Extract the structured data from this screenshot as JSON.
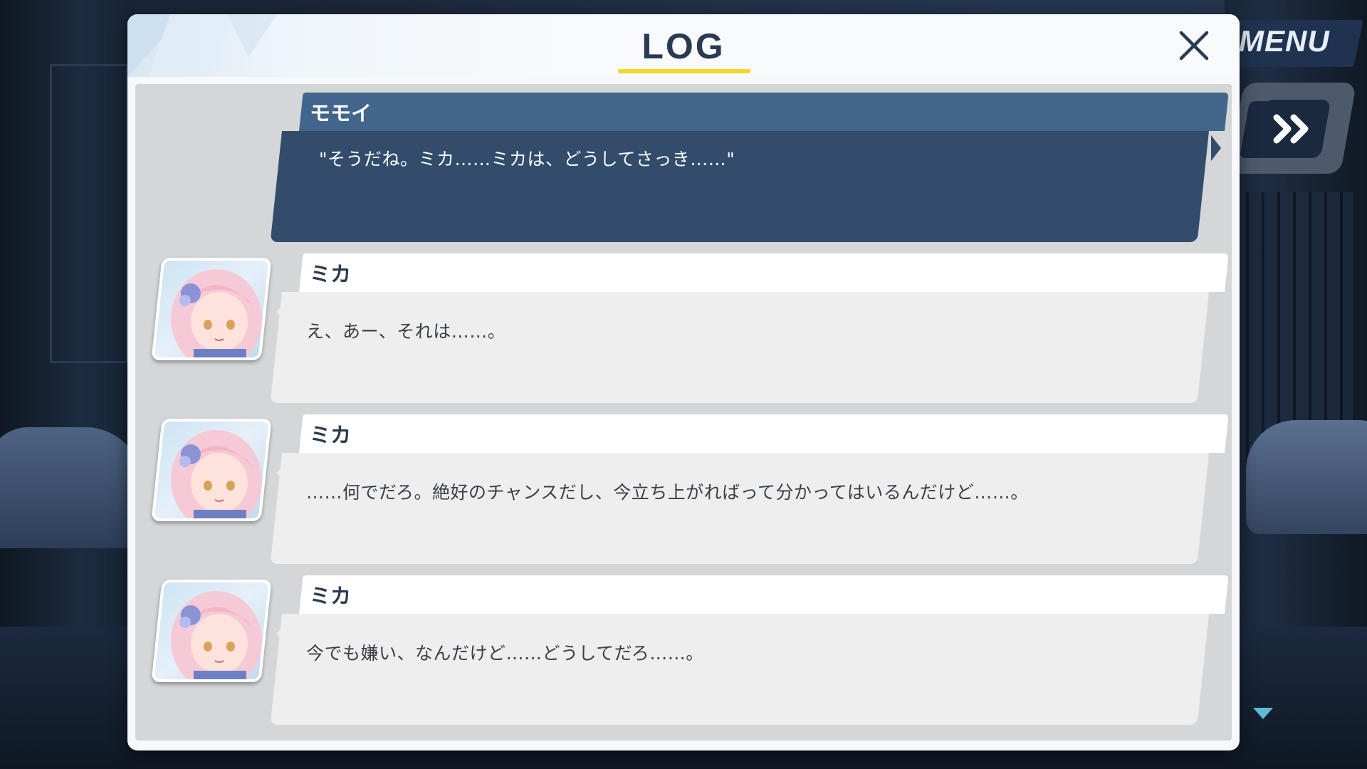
{
  "hud": {
    "menu_label": "MENU",
    "skip_icon": "fast-forward-icon"
  },
  "log": {
    "title": "LOG",
    "close_icon": "close-icon",
    "entries": [
      {
        "speaker": "モモイ",
        "text": "\"そうだね。ミカ……ミカは、どうしてさっき……\"",
        "current": true,
        "has_portrait": false
      },
      {
        "speaker": "ミカ",
        "text": "え、あー、それは……。",
        "current": false,
        "has_portrait": true
      },
      {
        "speaker": "ミカ",
        "text": "……何でだろ。絶好のチャンスだし、今立ち上がればって分かってはいるんだけど……。",
        "current": false,
        "has_portrait": true
      },
      {
        "speaker": "ミカ",
        "text": "今でも嫌い、なんだけど……どうしてだろ……。",
        "current": false,
        "has_portrait": true
      }
    ],
    "scroll_icon": "scroll-down-arrow-icon"
  },
  "colors": {
    "current_name_bar": "#42658c",
    "current_body": "#334c6c",
    "accent_underline": "#f5d62a",
    "title": "#2a3a52"
  }
}
